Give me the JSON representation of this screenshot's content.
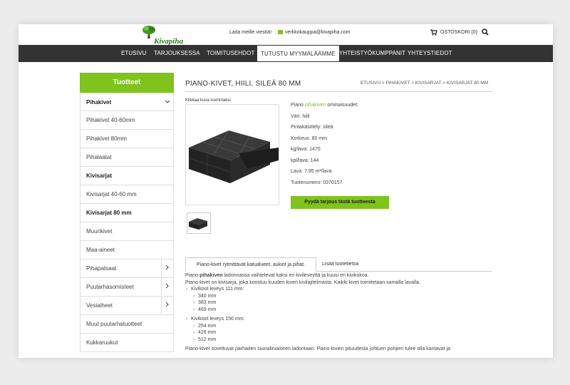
{
  "header": {
    "logo_text": "Kivapiha Oy",
    "message_link": "Laita meille viestiä!",
    "email": "verkkokauppa@kivapiha.com",
    "cart_label": "OSTOSKORI (0)"
  },
  "nav": {
    "items": [
      "ETUSIVU",
      "TARJOUKSESSA",
      "TOIMITUSEHDOT",
      "TUTUSTU MYYMÄLÄÄMME",
      "YHTEISTYÖKUMPPANIT",
      "YHTEYSTIEDOT"
    ]
  },
  "sidebar": {
    "heading": "Tuotteet",
    "items": [
      {
        "label": "Pihakivet",
        "bold": true,
        "arrow": "chevron-down"
      },
      {
        "label": "Pihakivet 40-60mm"
      },
      {
        "label": "Pihakivet 80mm"
      },
      {
        "label": "Pihalaatat"
      },
      {
        "label": "Kivisarjat",
        "bold": true
      },
      {
        "label": "Kivisarjat 40-60 mm"
      },
      {
        "label": "Kivisarjat 80 mm",
        "bold": true
      },
      {
        "label": "Muurikivet"
      },
      {
        "label": "Maa-aineet"
      },
      {
        "label": "Pihapatsaat",
        "arrow": "chevron-right"
      },
      {
        "label": "Puutarhasomisteet",
        "arrow": "chevron-right"
      },
      {
        "label": "Vesiaiheet",
        "arrow": "chevron-right"
      },
      {
        "label": "Muut puutarhatuotteet"
      },
      {
        "label": "Kukkaruukut"
      }
    ]
  },
  "product": {
    "title": "PIANO-KIVET, HIILI, SILEÄ 80 MM",
    "breadcrumb": "ETUSIVU > PIHAKIVET > KIVISARJAT > KIVISARJAT 80 MM",
    "click_note": "Klikkaa kuva isommaksi",
    "props_intro_pre": "Piano ",
    "props_intro_link": "pihakiven",
    "props_intro_post": " ominaisuudet:",
    "props": [
      "Väri: hiili",
      "Pintakäsittely: sileä",
      "Korkeus: 80 mm",
      "kg/lava: 1470",
      "kpl/lava: 144",
      "Lava: 7,95 m²/lava",
      "Tuotenumero: 0370157"
    ],
    "quote_button": "Pyydä tarjous tästä tuotteesta"
  },
  "tabs": {
    "active": "Piano-kivet rytmittävät katualueet, aukiot ja pihat.",
    "other": "Lisää tuotetietoa"
  },
  "description": {
    "line1_pre": "Piano-",
    "line1_bold": "pihakiven",
    "line1_post": " ladonnassa vaihtelevat kaksi eri kivileveyttä ja kuusi eri kivikokoa.",
    "line2": "Piano-kivet on kivisarja, joka koostuu kuuden kiven kivilajitelmasta. Kaikki kivet toimitetaan samalla lavalla.",
    "group1_label": "Kivikoot leveys 111 mm:",
    "group1": [
      "340 mm",
      "383 mm",
      "469 mm"
    ],
    "group2_label": "Kivikoot leveys 156 mm:",
    "group2": [
      "254 mm",
      "426 mm",
      "512 mm"
    ],
    "line3": "Piano-kivet soveltuvat parhaiten suoraliniaiseen ladontaan. Piano-kivien pituudesta johtuen pohjien tulee olla kantavat ja"
  },
  "colors": {
    "accent": "#7fc31c",
    "nav_bg": "#333333"
  }
}
